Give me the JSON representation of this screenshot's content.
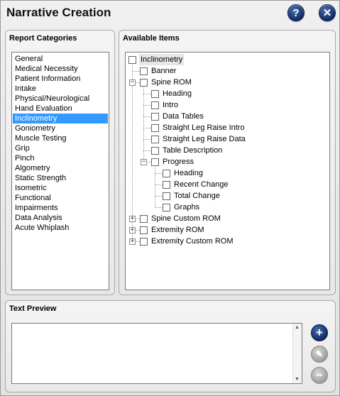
{
  "window": {
    "title": "Narrative Creation",
    "help_icon": "?",
    "close_icon": "✕"
  },
  "categories": {
    "label": "Report Categories",
    "selected": "Inclinometry",
    "items": [
      "General",
      "Medical Necessity",
      "Patient Information",
      "Intake",
      "Physical/Neurological",
      "Hand Evaluation",
      "Inclinometry",
      "Goniometry",
      "Muscle Testing",
      "Grip",
      "Pinch",
      "Algometry",
      "Static Strength",
      "Isometric",
      "Functional",
      "Impairments",
      "Data Analysis",
      "Acute Whiplash"
    ]
  },
  "available": {
    "label": "Available Items",
    "tree": [
      {
        "label": "Inclinometry",
        "level": 0,
        "expander": "none"
      },
      {
        "label": "Banner",
        "level": 1,
        "expander": "none"
      },
      {
        "label": "Spine ROM",
        "level": 1,
        "expander": "minus"
      },
      {
        "label": "Heading",
        "level": 2,
        "expander": "none"
      },
      {
        "label": "Intro",
        "level": 2,
        "expander": "none"
      },
      {
        "label": "Data Tables",
        "level": 2,
        "expander": "none"
      },
      {
        "label": "Straight Leg Raise Intro",
        "level": 2,
        "expander": "none"
      },
      {
        "label": "Straight Leg Raise Data",
        "level": 2,
        "expander": "none"
      },
      {
        "label": "Table Description",
        "level": 2,
        "expander": "none"
      },
      {
        "label": "Progress",
        "level": 2,
        "expander": "minus"
      },
      {
        "label": "Heading",
        "level": 3,
        "expander": "none"
      },
      {
        "label": "Recent Change",
        "level": 3,
        "expander": "none"
      },
      {
        "label": "Total Change",
        "level": 3,
        "expander": "none"
      },
      {
        "label": "Graphs",
        "level": 3,
        "expander": "none"
      },
      {
        "label": "Spine Custom ROM",
        "level": 1,
        "expander": "plus"
      },
      {
        "label": "Extremity ROM",
        "level": 1,
        "expander": "plus"
      },
      {
        "label": "Extremity Custom ROM",
        "level": 1,
        "expander": "plus"
      }
    ]
  },
  "preview": {
    "label": "Text Preview",
    "text": "",
    "add_icon": "+",
    "edit_icon": "✎",
    "remove_icon": "−"
  }
}
